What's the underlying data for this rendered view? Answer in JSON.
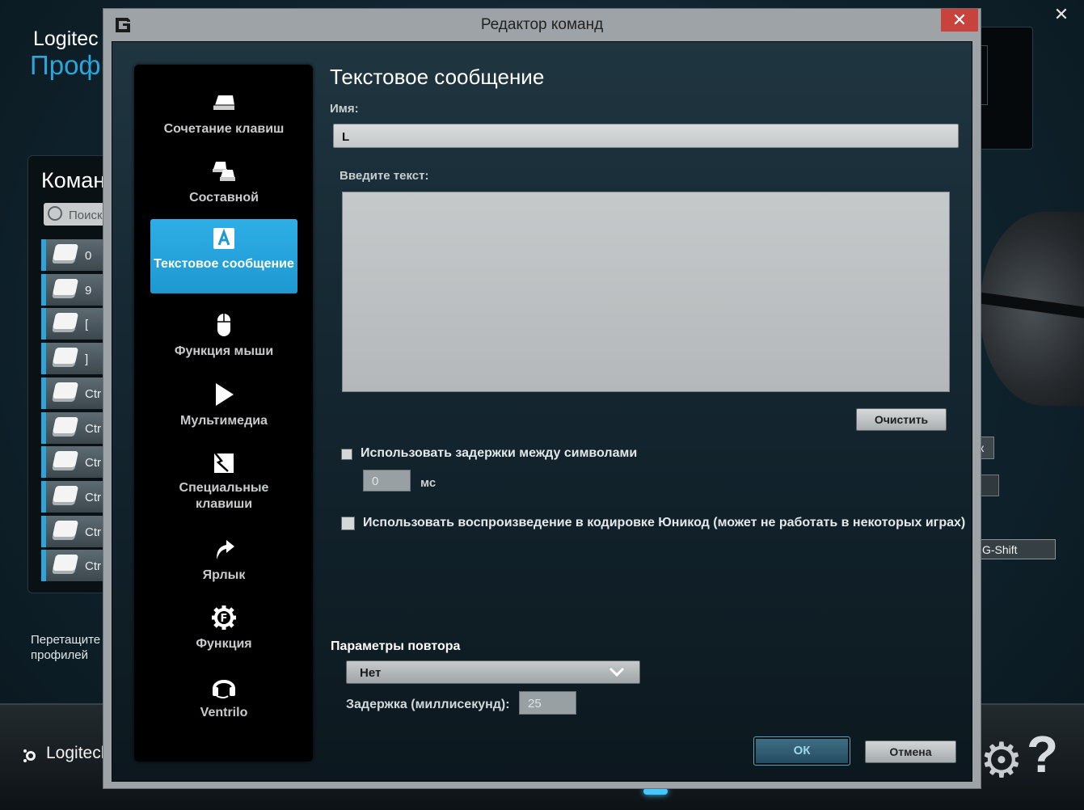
{
  "background": {
    "brand": "Logitec",
    "profiles_title": "Профи",
    "commands_title": "Коман",
    "search_placeholder": "Поиск",
    "command_items": [
      "0",
      "9",
      "[",
      "]",
      "Ctr",
      "Ctr",
      "Ctr",
      "Ctr",
      "Ctr",
      "Ctr"
    ],
    "drag_hint_line1": "Перетащите",
    "drag_hint_line2": "профилей",
    "k_button": "к",
    "gshift_button": "G-Shift",
    "logo_text": "Logitech",
    "help_glyph": "?",
    "close_glyph": "✕",
    "accent_color": "#29a6dc"
  },
  "dialog": {
    "title": "Редактор команд",
    "close_glyph": "✕",
    "sidebar": {
      "items": [
        {
          "label": "Сочетание клавиш",
          "icon": "key-icon"
        },
        {
          "label": "Составной",
          "icon": "multikey-icon"
        },
        {
          "label": "Текстовое сообщение",
          "icon": "text-a-icon",
          "active": true
        },
        {
          "label": "Функция мыши",
          "icon": "mouse-icon"
        },
        {
          "label": "Мультимедиа",
          "icon": "play-icon"
        },
        {
          "label": "Специальные клавиши",
          "icon": "special-key-icon"
        },
        {
          "label": "Ярлык",
          "icon": "shortcut-arrow-icon"
        },
        {
          "label": "Функция",
          "icon": "function-gear-icon"
        },
        {
          "label": "Ventrilo",
          "icon": "headset-icon"
        }
      ]
    },
    "main": {
      "heading": "Текстовое сообщение",
      "name_label": "Имя:",
      "name_value": "L",
      "text_label": "Введите текст:",
      "text_value": "",
      "clear_button": "Очистить",
      "delay_checkbox_label": "Использовать задержки между символами",
      "delay_checked": false,
      "delay_value": "0",
      "delay_unit": "мс",
      "unicode_checkbox_label": "Использовать воспроизведение в кодировке Юникод (может не работать в некоторых играх)",
      "unicode_checked": false,
      "repeat_title": "Параметры повтора",
      "repeat_selected": "Нет",
      "repeat_delay_label": "Задержка (миллисекунд):",
      "repeat_delay_value": "25",
      "ok_button": "ОК",
      "cancel_button": "Отмена"
    }
  }
}
